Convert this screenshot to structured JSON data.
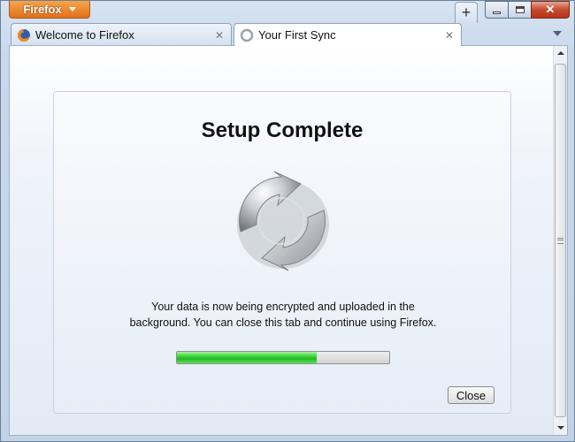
{
  "app_button": {
    "label": "Firefox",
    "icon": "chevron-down-icon"
  },
  "window_controls": {
    "minimize_icon": "minimize-icon",
    "maximize_icon": "maximize-icon",
    "close_icon": "close-icon",
    "close_glyph": "✕"
  },
  "tabs": [
    {
      "label": "Welcome to Firefox",
      "icon": "firefox-icon",
      "close_glyph": "✕",
      "active": false
    },
    {
      "label": "Your First Sync",
      "icon": "sync-icon",
      "close_glyph": "✕",
      "active": true
    }
  ],
  "new_tab": {
    "glyph": "+"
  },
  "page": {
    "title": "Setup Complete",
    "message": "Your data is now being encrypted and uploaded in the background. You can close this tab and continue using Firefox.",
    "progress_percent": 66,
    "close_label": "Close"
  },
  "colors": {
    "app_button": "#e87d22",
    "progress_fill": "#2fc62f",
    "window_close": "#c54a2e"
  }
}
